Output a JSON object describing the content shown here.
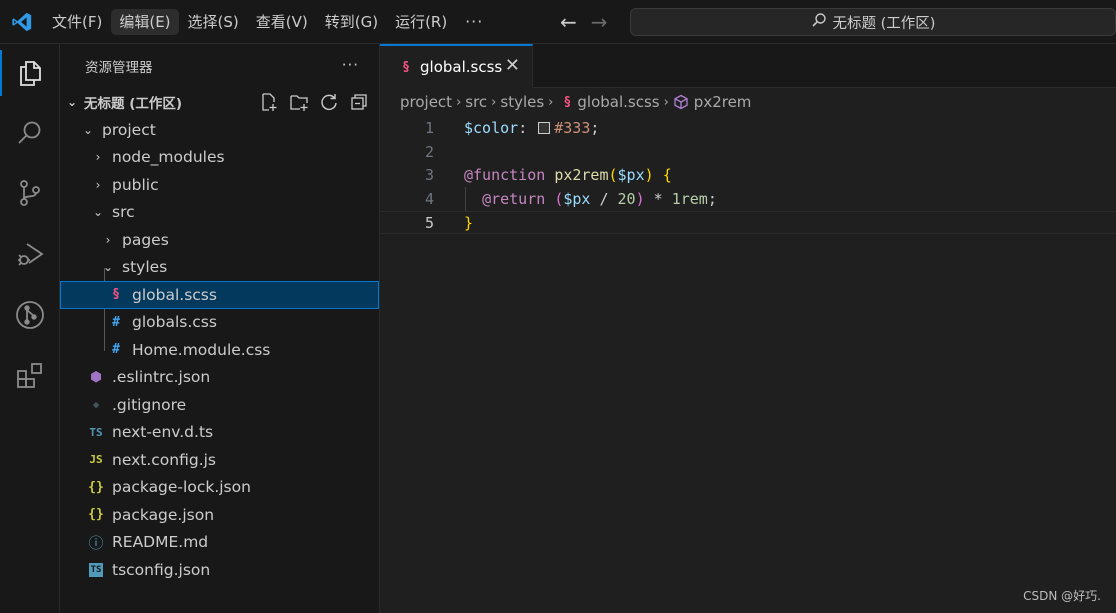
{
  "menu": [
    "文件(F)",
    "编辑(E)",
    "选择(S)",
    "查看(V)",
    "转到(G)",
    "运行(R)"
  ],
  "menu_more": "···",
  "command_center": {
    "label": "无标题 (工作区)",
    "icon": "search-icon"
  },
  "activity_bar": [
    "explorer-icon",
    "search-icon",
    "source-control-icon",
    "run-debug-icon",
    "git-graph-icon",
    "extensions-icon"
  ],
  "sidebar": {
    "title": "资源管理器",
    "more": "···",
    "workspace": "无标题 (工作区)",
    "actions": [
      "new-file-icon",
      "new-folder-icon",
      "refresh-icon",
      "collapse-all-icon"
    ],
    "tree": [
      {
        "label": "project",
        "icon": "",
        "chevron": "⌄"
      },
      {
        "label": "node_modules",
        "icon": "",
        "chevron": "›"
      },
      {
        "label": "public",
        "icon": "",
        "chevron": "›"
      },
      {
        "label": "src",
        "icon": "",
        "chevron": "⌄"
      },
      {
        "label": "pages",
        "icon": "",
        "chevron": "›"
      },
      {
        "label": "styles",
        "icon": "",
        "chevron": "⌄"
      },
      {
        "label": "global.scss",
        "icon": "§",
        "chevron": ""
      },
      {
        "label": "globals.css",
        "icon": "#",
        "chevron": ""
      },
      {
        "label": "Home.module.css",
        "icon": "#",
        "chevron": ""
      },
      {
        "label": ".eslintrc.json",
        "icon": "⬢",
        "chevron": ""
      },
      {
        "label": ".gitignore",
        "icon": "◆",
        "chevron": ""
      },
      {
        "label": "next-env.d.ts",
        "icon": "TS",
        "chevron": ""
      },
      {
        "label": "next.config.js",
        "icon": "JS",
        "chevron": ""
      },
      {
        "label": "package-lock.json",
        "icon": "{}",
        "chevron": ""
      },
      {
        "label": "package.json",
        "icon": "{}",
        "chevron": ""
      },
      {
        "label": "README.md",
        "icon": "ⓘ",
        "chevron": ""
      },
      {
        "label": "tsconfig.json",
        "icon": "TS",
        "chevron": ""
      }
    ]
  },
  "editor": {
    "tab": "global.scss",
    "tab_close": "✕",
    "breadcrumbs": [
      "project",
      "src",
      "styles",
      "global.scss",
      "px2rem"
    ],
    "line_numbers": [
      "1",
      "2",
      "3",
      "4",
      "5"
    ],
    "code": {
      "l1_var": "$color",
      "l1_colon": ": ",
      "l1_hex": "#333",
      "l1_semi": ";",
      "l3_at": "@function",
      "l3_fn": "px2rem",
      "l3_open": "(",
      "l3_param": "$px",
      "l3_close": ")",
      "l3_brace": "{",
      "l4_at": "@return",
      "l4_open": "(",
      "l4_var": "$px",
      "l4_div": " / ",
      "l4_num": "20",
      "l4_close": ")",
      "l4_mul": " * ",
      "l4_rem": "1rem",
      "l4_semi": ";",
      "l5_brace": "}"
    }
  },
  "watermark": "CSDN @好巧.",
  "colors": {
    "accent": "#0078d4",
    "selected_row": "#04395e",
    "scss_icon": "#f55385",
    "css_icon": "#42a5f5",
    "js_icon": "#cbcb41"
  }
}
